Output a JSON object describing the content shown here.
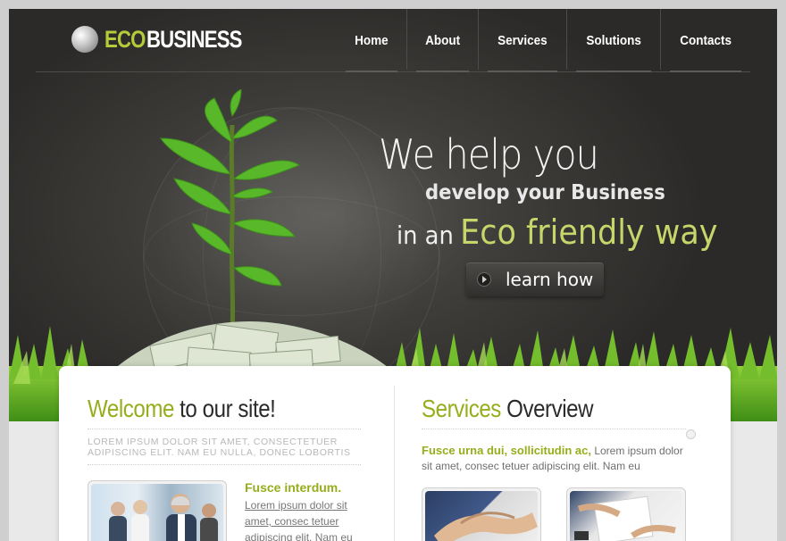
{
  "logo": {
    "eco": "ECO",
    "business": "BUSINESS"
  },
  "nav": [
    {
      "label": "Home"
    },
    {
      "label": "About"
    },
    {
      "label": "Services"
    },
    {
      "label": "Solutions"
    },
    {
      "label": "Contacts"
    }
  ],
  "hero": {
    "line1": "We help you",
    "line2": "develop your Business",
    "line3_prefix": "in an",
    "line3_highlight": "Eco friendly way",
    "button_label": "learn how"
  },
  "welcome": {
    "title_green": "Welcome",
    "title_dark": "to our site!",
    "caps_text": "LOREM IPSUM DOLOR SIT AMET, CONSECTETUER ADIPISCING ELIT. NAM EU NULLA, DONEC LOBORTIS",
    "subheading": "Fusce interdum.",
    "link_text": "Lorem ipsum dolor sit amet, consec tetuer adipiscing elit. Nam eu nulla. Donec lobortis"
  },
  "services": {
    "title_green": "Services",
    "title_dark": "Overview",
    "lead_bold": "Fusce urna dui, sollicitudin ac,",
    "lead_text": "Lorem ipsum dolor sit amet, consec tetuer adipiscing elit. Nam eu"
  },
  "colors": {
    "accent": "#97ad1c",
    "hero_bg": "#3f3e3b",
    "logo_green": "#b5cc3a"
  }
}
